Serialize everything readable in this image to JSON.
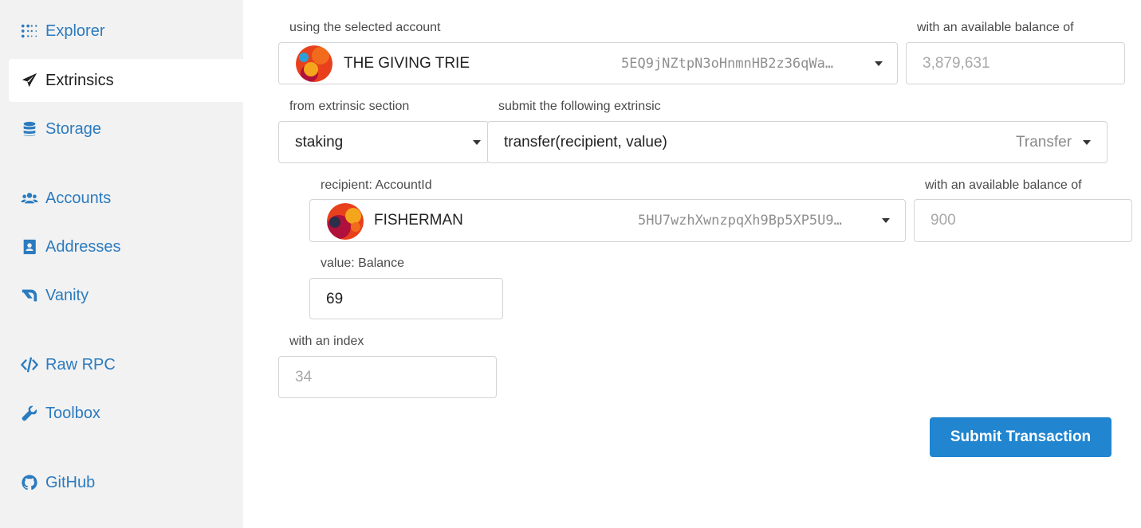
{
  "sidebar": {
    "items": [
      {
        "label": "Explorer",
        "icon": "dots-grid-icon"
      },
      {
        "label": "Extrinsics",
        "icon": "paper-plane-icon",
        "active": true
      },
      {
        "label": "Storage",
        "icon": "database-icon"
      },
      {
        "label": "Accounts",
        "icon": "users-icon"
      },
      {
        "label": "Addresses",
        "icon": "address-book-icon"
      },
      {
        "label": "Vanity",
        "icon": "vanity-icon"
      },
      {
        "label": "Raw RPC",
        "icon": "code-icon"
      },
      {
        "label": "Toolbox",
        "icon": "wrench-icon"
      },
      {
        "label": "GitHub",
        "icon": "github-icon"
      }
    ]
  },
  "account": {
    "label": "using the selected account",
    "name": "THE GIVING TRIE",
    "address": "5EQ9jNZtpN3oHnmnHB2z36qWa…",
    "balance_label": "with an available balance of",
    "balance": "3,879,631"
  },
  "section": {
    "label": "from extrinsic section",
    "value": "staking"
  },
  "extrinsic": {
    "label": "submit the following extrinsic",
    "value": "transfer(recipient, value)",
    "hint": "Transfer"
  },
  "recipient": {
    "label": "recipient: AccountId",
    "name": "FISHERMAN",
    "address": "5HU7wzhXwnzpqXh9Bp5XP5U9…",
    "balance_label": "with an available balance of",
    "balance": "900"
  },
  "value": {
    "label": "value: Balance",
    "amount": "69"
  },
  "index": {
    "label": "with an index",
    "value": "34"
  },
  "submit_label": "Submit Transaction",
  "colors": {
    "accent": "#2185d0",
    "nav_link": "#2b7bbf",
    "sidebar_bg": "#f2f2f2"
  }
}
